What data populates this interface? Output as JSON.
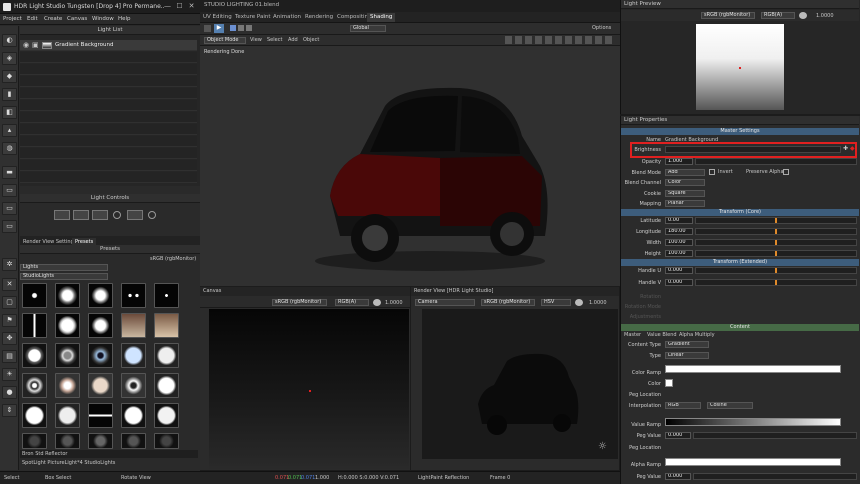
{
  "window": {
    "title": "HDR Light Studio Tungsten [Drop 4] Pro Permane...",
    "min": "—",
    "max": "☐",
    "close": "✕"
  },
  "menu": [
    "Project",
    "Edit",
    "Create",
    "Canvas",
    "Window",
    "Help"
  ],
  "light_list": {
    "title": "Light List",
    "item": "Gradient Background",
    "icons": [
      "eye-icon",
      "lock-icon"
    ]
  },
  "light_controls": {
    "title": "Light Controls"
  },
  "presets": {
    "tabs": [
      "Render View Settings",
      "Presets"
    ],
    "title": "Presets",
    "colorspace": "sRGB (rgbMonitor)",
    "category": "Lights",
    "subcategory": "StudioLights",
    "selected": "Bron Std Reflector",
    "footer": "SpotLight PictureLight*4 StudioLights"
  },
  "left_status": {
    "select": "Select",
    "box": "Box Select",
    "rotate": "Rotate View"
  },
  "top_tabs": [
    "UV Editing",
    "Texture Paint",
    "Animation",
    "Rendering",
    "Compositing",
    "Shading"
  ],
  "blend_title": "STUDIO LIGHTING 01.blend",
  "header2": {
    "global": "Global",
    "options": "Options"
  },
  "header3": {
    "mode": "Object Mode",
    "items": [
      "View",
      "Select",
      "Add",
      "Object"
    ]
  },
  "viewport": {
    "status": "Rendering Done"
  },
  "canvas": {
    "title": "Canvas",
    "cs": "sRGB (rgbMonitor)",
    "ch": "RGB(A)",
    "val": "1.0000"
  },
  "render_view": {
    "title": "Render View [HDR Light Studio]",
    "camera": "Camera",
    "cs": "sRGB (rgbMonitor)",
    "mode": "HSV",
    "val": "1.0000",
    "bottom": "LightPaint Reflection",
    "frame": "Frame 0"
  },
  "main_status": {
    "coords": "H:0.000 S:0.000 V:0.071",
    "rgb_r": "0.071",
    "rgb_g": "0.071",
    "rgb_b": "0.071",
    "alpha": "1.000"
  },
  "light_preview": {
    "title": "Light Preview",
    "cs": "sRGB (rgbMonitor)",
    "ch": "RGB(A)",
    "val": "1.0000"
  },
  "light_props": {
    "title": "Light Properties",
    "master_settings": "Master Settings",
    "name_label": "Name",
    "name": "Gradient Background",
    "brightness_label": "Brightness",
    "opacity_label": "Opacity",
    "opacity": "1.000",
    "blend_label": "Blend Mode",
    "blend": "Add",
    "invert": "Invert",
    "preserve": "Preserve Alpha",
    "channel_label": "Blend Channel",
    "channel": "Color",
    "cookie_label": "Cookie",
    "cookie": "Square",
    "mapping_label": "Mapping",
    "mapping": "Planar",
    "transform_core": "Transform (Core)",
    "latitude_label": "Latitude",
    "latitude": "0.00",
    "longitude_label": "Longitude",
    "longitude": "180.00",
    "width_label": "Width",
    "width": "100.00",
    "height_label": "Height",
    "height": "100.00",
    "transform_ext": "Transform (Extended)",
    "handleu_label": "Handle U",
    "handleu": "0.000",
    "handlev_label": "Handle V",
    "handlev": "0.000",
    "rotation_label": "Rotation",
    "rotation_mode_label": "Rotation Mode",
    "adjust_label": "Adjustments",
    "content": "Content",
    "subtabs": [
      "Master",
      "Value Blend",
      "Alpha Multiply"
    ],
    "ctype_label": "Content Type",
    "ctype": "Gradient",
    "type_label": "Type",
    "type": "Linear",
    "colorramp_label": "Color Ramp",
    "color_label": "Color",
    "peg_loc_label": "Peg Location",
    "interp_label": "Interpolation",
    "interp_a": "RGB",
    "interp_b": "Cosine",
    "valueramp_label": "Value Ramp",
    "pegval_label": "Peg Value",
    "pegval": "0.000",
    "peg_loc2_label": "Peg Location",
    "alpharamp_label": "Alpha Ramp",
    "pegval2_label": "Peg Value",
    "pegval2": "0.000"
  },
  "colors": {
    "accent": "#e02020",
    "section": "#3d5d7c",
    "content": "#466a46",
    "orange": "#e08a2a"
  }
}
